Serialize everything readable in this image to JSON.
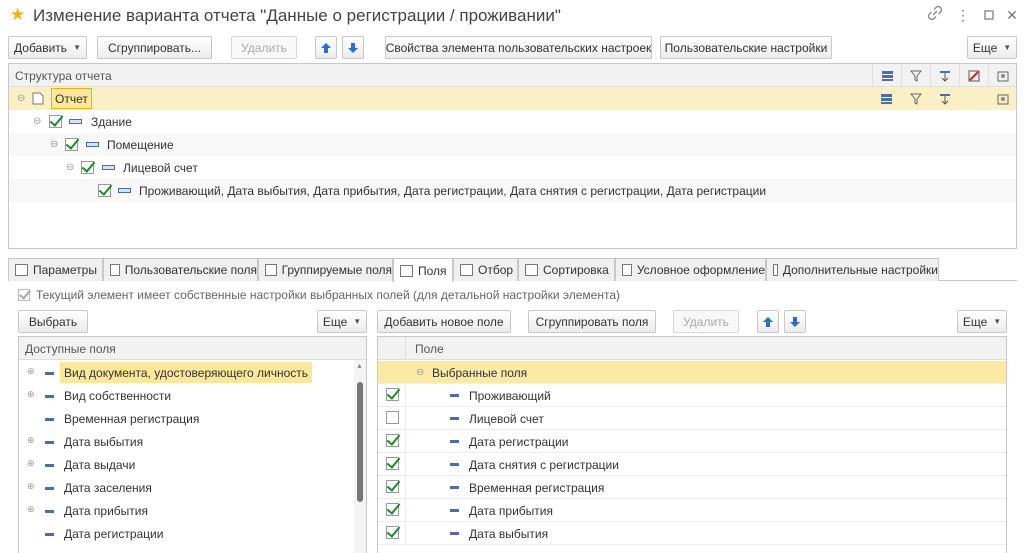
{
  "window": {
    "title": "Изменение варианта отчета \"Данные о регистрации / проживании\"",
    "star_icon": "star-icon",
    "link_icon": "link-icon",
    "more_icon": "more-icon",
    "maximize_icon": "maximize-icon",
    "close_icon": "close-icon"
  },
  "toolbar": {
    "add_label": "Добавить",
    "group_label": "Сгруппировать...",
    "delete_label": "Удалить",
    "properties_label": "Свойства элемента пользовательских настроек",
    "user_settings_label": "Пользовательские настройки",
    "more_label": "Еще"
  },
  "structure": {
    "header": "Структура отчета",
    "rows": [
      {
        "label": "Отчет"
      },
      {
        "label": "Здание"
      },
      {
        "label": "Помещение"
      },
      {
        "label": "Лицевой счет"
      },
      {
        "label": "Проживающий, Дата выбытия, Дата прибытия, Дата регистрации, Дата снятия с регистрации, Дата регистрации"
      }
    ]
  },
  "tabs": [
    {
      "label": "Параметры"
    },
    {
      "label": "Пользовательские поля"
    },
    {
      "label": "Группируемые поля"
    },
    {
      "label": "Поля"
    },
    {
      "label": "Отбор"
    },
    {
      "label": "Сортировка"
    },
    {
      "label": "Условное оформление"
    },
    {
      "label": "Дополнительные настройки"
    }
  ],
  "own_settings_checkbox": "Текущий элемент имеет собственные настройки выбранных полей (для детальной настройки элемента)",
  "left": {
    "select_label": "Выбрать",
    "more_label": "Еще",
    "header": "Доступные поля",
    "items": [
      {
        "label": "Вид документа, удостоверяющего личность"
      },
      {
        "label": "Вид собственности"
      },
      {
        "label": "Временная регистрация"
      },
      {
        "label": "Дата выбытия"
      },
      {
        "label": "Дата выдачи"
      },
      {
        "label": "Дата заселения"
      },
      {
        "label": "Дата прибытия"
      },
      {
        "label": "Дата регистрации"
      }
    ]
  },
  "right": {
    "add_field_label": "Добавить новое поле",
    "group_fields_label": "Сгруппировать поля",
    "delete_label": "Удалить",
    "more_label": "Еще",
    "header": "Поле",
    "group_label": "Выбранные поля",
    "items": [
      {
        "label": "Проживающий",
        "checked": true
      },
      {
        "label": "Лицевой счет",
        "checked": false
      },
      {
        "label": "Дата регистрации",
        "checked": true
      },
      {
        "label": "Дата снятия с регистрации",
        "checked": true
      },
      {
        "label": "Временная регистрация",
        "checked": true
      },
      {
        "label": "Дата прибытия",
        "checked": true
      },
      {
        "label": "Дата выбытия",
        "checked": true
      }
    ]
  },
  "colors": {
    "selection": "#fde79a",
    "check_green": "#1a8a2a",
    "arrow_blue": "#2a6fd0",
    "star": "#f0b400"
  }
}
